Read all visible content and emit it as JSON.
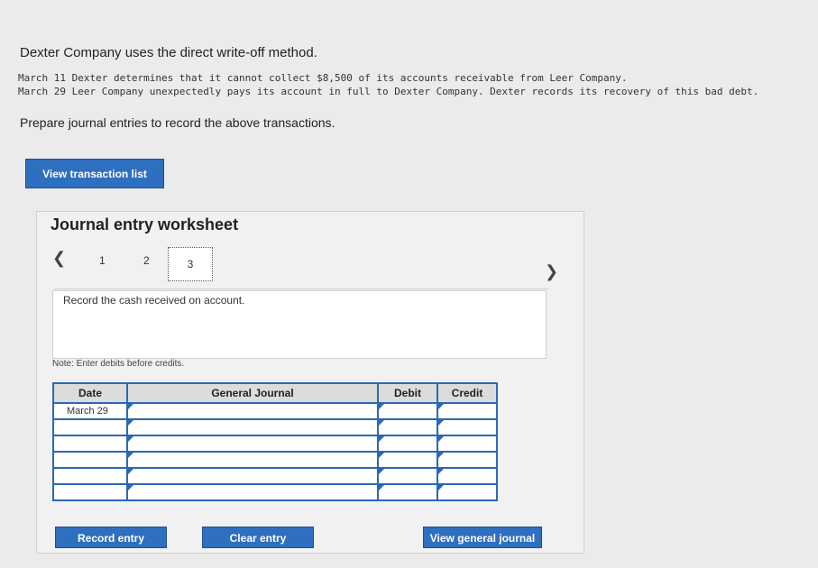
{
  "intro": "Dexter Company uses the direct write-off method.",
  "transactions": [
    "March 11 Dexter determines that it cannot collect $8,500 of its accounts receivable from Leer Company.",
    "March 29 Leer Company unexpectedly pays its account in full to Dexter Company. Dexter records its recovery of this bad debt."
  ],
  "prepare": "Prepare journal entries to record the above transactions.",
  "buttons": {
    "view_transaction_list": "View transaction list",
    "record_entry": "Record entry",
    "clear_entry": "Clear entry",
    "view_general_journal": "View general journal"
  },
  "worksheet": {
    "title": "Journal entry worksheet",
    "pages": [
      "1",
      "2",
      "3"
    ],
    "current_page": "3",
    "prev_icon": "chevron-left-icon",
    "next_icon": "chevron-right-icon",
    "instruction": "Record the cash received on account.",
    "note": "Note: Enter debits before credits."
  },
  "table": {
    "headers": [
      "Date",
      "General Journal",
      "Debit",
      "Credit"
    ],
    "rows": [
      {
        "date": "March 29",
        "account": "",
        "debit": "",
        "credit": ""
      },
      {
        "date": "",
        "account": "",
        "debit": "",
        "credit": ""
      },
      {
        "date": "",
        "account": "",
        "debit": "",
        "credit": ""
      },
      {
        "date": "",
        "account": "",
        "debit": "",
        "credit": ""
      },
      {
        "date": "",
        "account": "",
        "debit": "",
        "credit": ""
      },
      {
        "date": "",
        "account": "",
        "debit": "",
        "credit": ""
      }
    ]
  },
  "colors": {
    "accent": "#2f6fc0",
    "table_border": "#2a68b5"
  }
}
